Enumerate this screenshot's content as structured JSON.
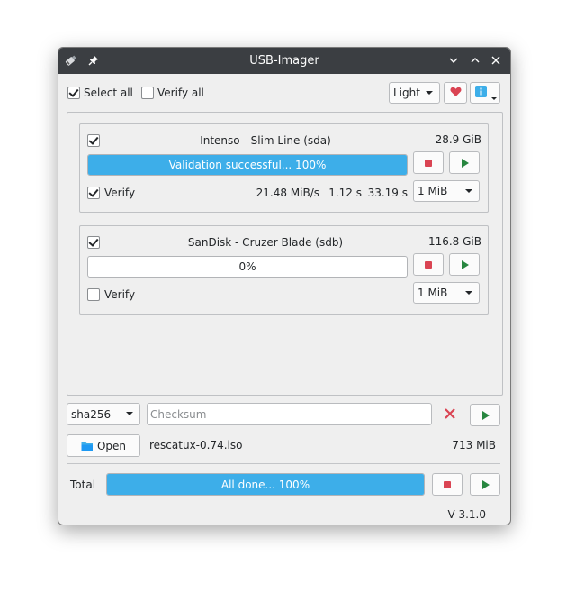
{
  "window": {
    "title": "USB-Imager"
  },
  "toolbar": {
    "select_all_label": "Select all",
    "select_all_checked": true,
    "verify_all_label": "Verify all",
    "verify_all_checked": false,
    "theme_value": "Light"
  },
  "devices": [
    {
      "name": "Intenso - Slim Line (sda)",
      "size": "28.9 GiB",
      "checked": true,
      "progress_text": "Validation successful... 100%",
      "progress": 100,
      "verify_label": "Verify",
      "verify_checked": true,
      "speed": "21.48 MiB/s",
      "time1": "1.12 s",
      "time2": "33.19 s",
      "block_size": "1 MiB"
    },
    {
      "name": "SanDisk - Cruzer Blade (sdb)",
      "size": "116.8 GiB",
      "checked": true,
      "progress_text": "0%",
      "progress": 0,
      "verify_label": "Verify",
      "verify_checked": false,
      "speed": "",
      "time1": "",
      "time2": "",
      "block_size": "1 MiB"
    }
  ],
  "checksum": {
    "algorithm": "sha256",
    "placeholder": "Checksum",
    "value": ""
  },
  "file": {
    "open_label": "Open",
    "name": "rescatux-0.74.iso",
    "size": "713 MiB"
  },
  "total": {
    "label": "Total",
    "progress_text": "All done... 100%",
    "progress": 100
  },
  "version": "V 3.1.0",
  "colors": {
    "accent": "#3daee9",
    "stop": "#da4453",
    "play": "#27863f",
    "heart": "#da4453",
    "info": "#3daee9"
  }
}
